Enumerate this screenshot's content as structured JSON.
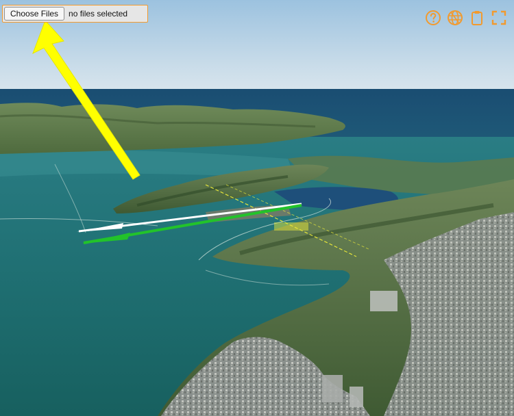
{
  "file_input": {
    "button_label": "Choose Files",
    "status_text": "no files selected"
  },
  "toolbar": {
    "accent_color": "#f29a2e",
    "icons": [
      "help-icon",
      "globe-icon",
      "clipboard-icon",
      "fullscreen-icon"
    ]
  },
  "annotation": {
    "arrow_color": "#ffff00",
    "points_to": "choose-files-button"
  },
  "scene": {
    "description_colors": {
      "sky_top": "#a9c8e0",
      "sea": "#1d6e72",
      "flight_track_white": "#ffffff",
      "flight_track_green": "#22c32a",
      "flight_track_yellow": "#e6e63a"
    }
  }
}
